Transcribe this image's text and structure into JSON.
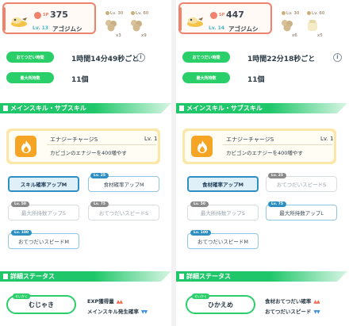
{
  "left": {
    "pokemon": {
      "sp_label": "SP",
      "sp": "375",
      "level": "Lv. 13",
      "name": "アゴジムシ"
    },
    "ingredients": [
      {
        "lv": "Lv. 30",
        "count": "x3"
      },
      {
        "lv": "Lv. 60",
        "count": "x9"
      }
    ],
    "help_time_label": "おてつだい時間",
    "help_time": "1時間14分49秒ごと",
    "max_label": "最大所持数",
    "max_value": "11個",
    "skills_header": "メインスキル・サブスキル",
    "main_skill": {
      "name": "エナジーチャージS",
      "level": "Lv. 1",
      "desc": "カビゴンのエナジーを400増やす"
    },
    "sub_skills": [
      {
        "badge": "",
        "label": "スキル確率アップM",
        "state": "active"
      },
      {
        "badge": "Lv. 25",
        "label": "食材確率アップM",
        "state": "unlocked"
      },
      {
        "badge": "Lv. 50",
        "label": "最大所持数アップS",
        "state": "locked"
      },
      {
        "badge": "Lv. 75",
        "label": "おてつだいスピードS",
        "state": "locked"
      },
      {
        "badge": "Lv. 100",
        "label": "おてつだいスピードM",
        "state": "unlocked"
      }
    ],
    "details_header": "詳細ステータス",
    "nature_tag": "せいかく",
    "nature": "むじゃき",
    "effects": [
      {
        "label": "EXP獲得量",
        "dir": "▲▲"
      },
      {
        "label": "メインスキル発生確率",
        "dir": "▼▼"
      }
    ]
  },
  "right": {
    "pokemon": {
      "sp_label": "SP",
      "sp": "447",
      "level": "Lv. 14",
      "name": "アゴジムシ"
    },
    "ingredients": [
      {
        "lv": "Lv. 30",
        "count": "x6"
      },
      {
        "lv": "Lv. 60",
        "count": "x5"
      }
    ],
    "help_time_label": "おてつだい時間",
    "help_time": "1時間22分18秒ごと",
    "max_label": "最大所持数",
    "max_value": "11個",
    "skills_header": "メインスキル・サブスキル",
    "main_skill": {
      "name": "エナジーチャージS",
      "level": "Lv. 1",
      "desc": "カビゴンのエナジーを400増やす"
    },
    "sub_skills": [
      {
        "badge": "",
        "label": "食材確率アップM",
        "state": "active"
      },
      {
        "badge": "Lv. 25",
        "label": "おてつだいスピードS",
        "state": "locked"
      },
      {
        "badge": "Lv. 50",
        "label": "最大所持数アップS",
        "state": "locked"
      },
      {
        "badge": "Lv. 75",
        "label": "最大所持数アップL",
        "state": "unlocked"
      },
      {
        "badge": "Lv. 100",
        "label": "おてつだいスピードM",
        "state": "unlocked"
      }
    ],
    "details_header": "詳細ステータス",
    "nature_tag": "せいかく",
    "nature": "ひかえめ",
    "effects": [
      {
        "label": "食材おてつだい確率",
        "dir": "▲▲"
      },
      {
        "label": "おてつだいスピード",
        "dir": "▼▼"
      }
    ]
  },
  "colors": {
    "accent_green": "#2bcf6a",
    "accent_coral": "#f0826c",
    "skill_orange": "#f5a523",
    "active_blue": "#2f8fc0"
  },
  "icons": [
    "fire-icon",
    "info-icon",
    "flame-skill-icon",
    "pokemon-sprite",
    "ingredient-icon"
  ]
}
